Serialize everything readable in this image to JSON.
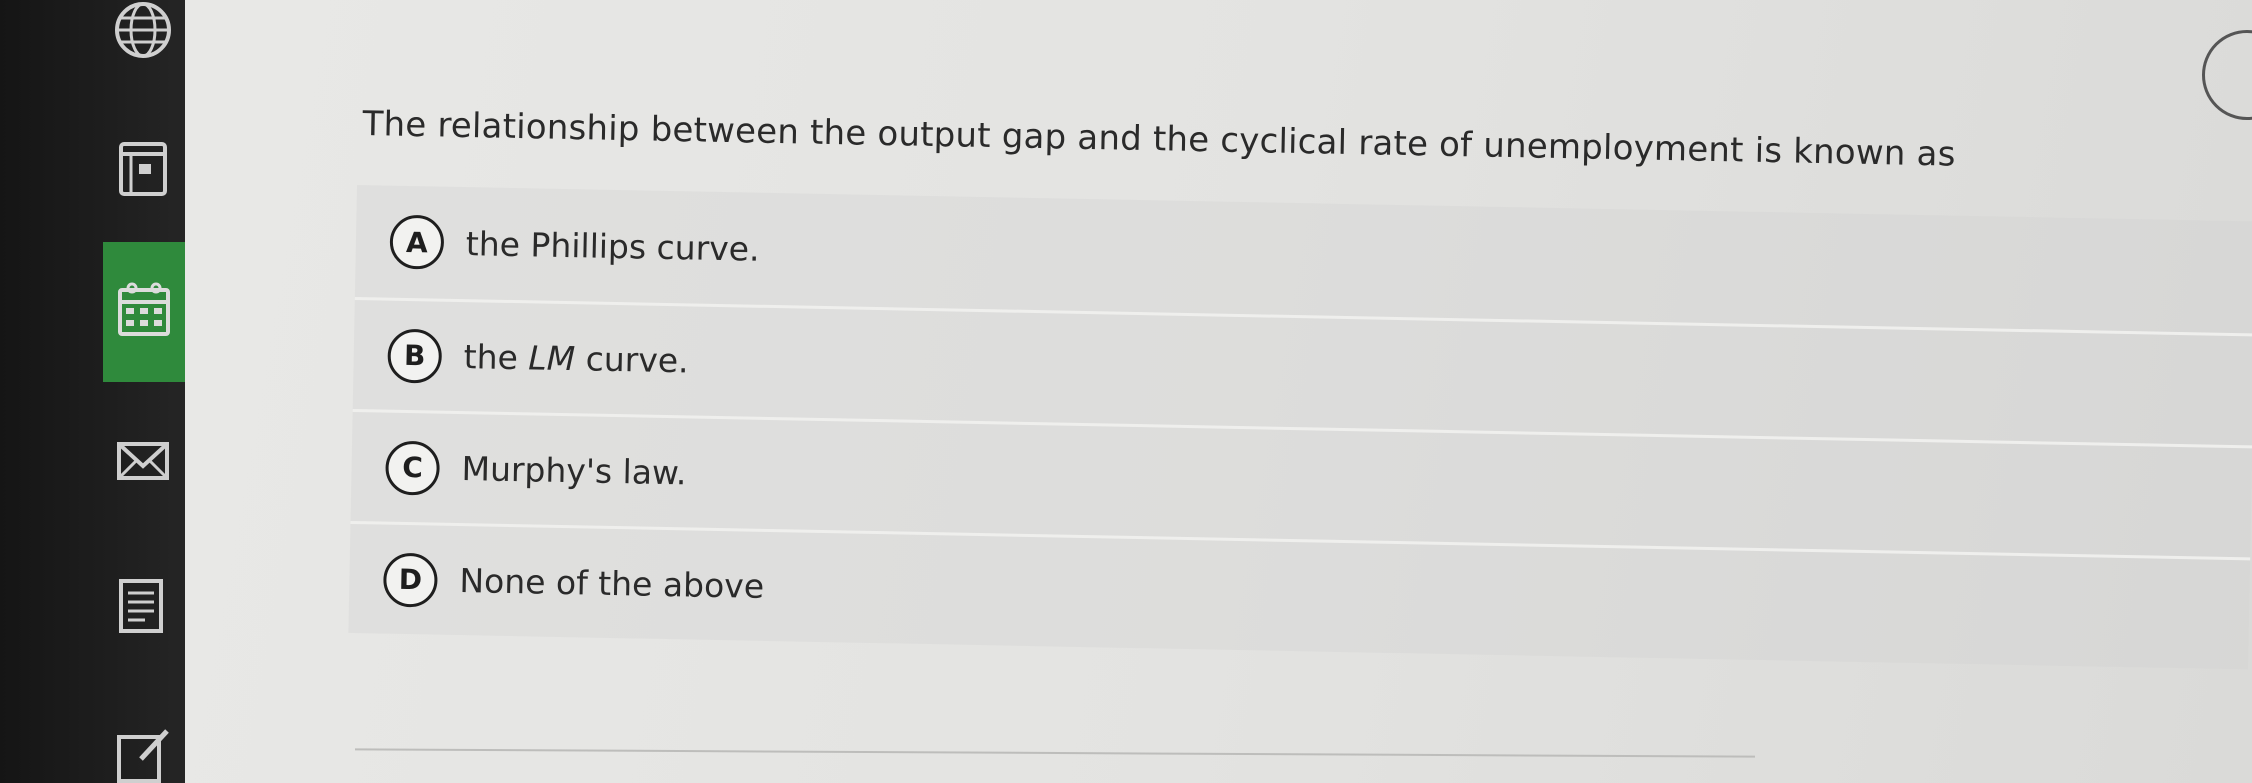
{
  "question": {
    "text": "The relationship between the output gap and the cyclical rate of unemployment is known as"
  },
  "options": [
    {
      "letter": "A",
      "pre": "the Phillips curve.",
      "em": "",
      "post": ""
    },
    {
      "letter": "B",
      "pre": "the ",
      "em": "LM",
      "post": " curve."
    },
    {
      "letter": "C",
      "pre": "Murphy's law.",
      "em": "",
      "post": ""
    },
    {
      "letter": "D",
      "pre": "None of the above",
      "em": "",
      "post": ""
    }
  ],
  "sidebar": {
    "icons": [
      "globe-icon",
      "book-icon",
      "calendar-icon",
      "mail-icon",
      "notes-icon",
      "edit-icon"
    ],
    "active_index": 2,
    "active_color": "#2f8a3c"
  }
}
